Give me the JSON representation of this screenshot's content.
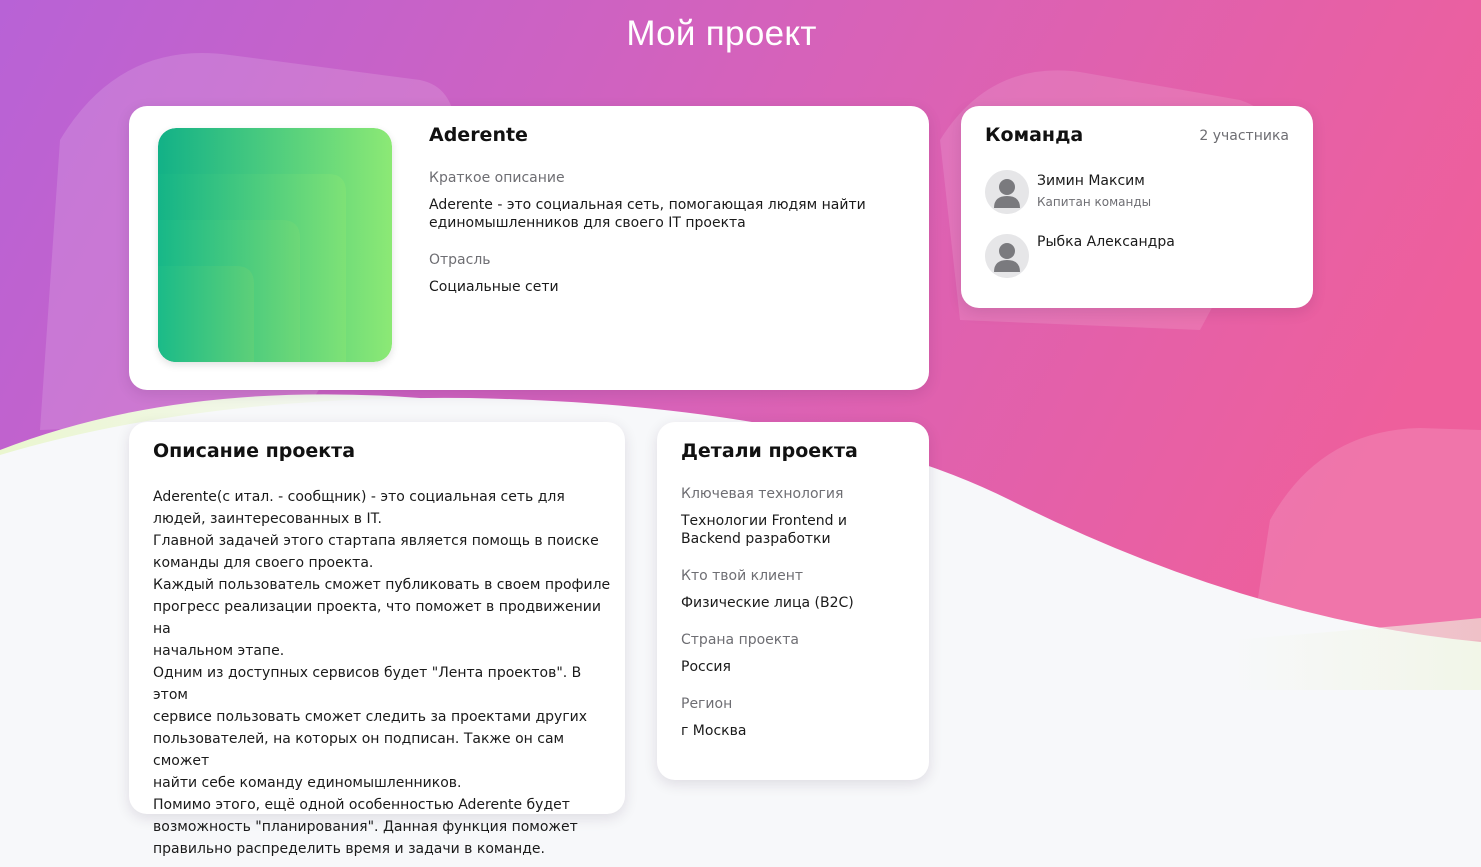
{
  "page_title": "Мой проект",
  "project": {
    "name": "Aderente",
    "short_description_label": "Краткое описание",
    "short_description_line1": "Aderente - это социальная сеть, помогающая людям найти",
    "short_description_line2": "единомышленников для своего IT проекта",
    "industry_label": "Отрасль",
    "industry_value": "Социальные сети"
  },
  "team": {
    "title": "Команда",
    "count": "2 участника",
    "members": [
      {
        "name": "Зимин Максим",
        "role": "Капитан команды"
      },
      {
        "name": "Рыбка Александра",
        "role": ""
      }
    ]
  },
  "description": {
    "title": "Описание проекта",
    "lines": [
      "Aderente(с итал. - сообщник) - это социальная сеть для",
      "людей, заинтересованных в IT.",
      "Главной задачей этого стартапа является помощь в поиске",
      "команды для своего проекта.",
      "Каждый пользователь сможет публиковать в своем профиле",
      "прогресс реализации проекта, что поможет в продвижении на",
      "начальном этапе.",
      "Одним из доступных сервисов будет \"Лента проектов\". В этом",
      "сервисе пользовать сможет следить за проектами других",
      "пользователей, на которых он подписан. Также он сам сможет",
      "найти себе команду единомышленников.",
      "Помимо этого, ещё одной особенностью Aderente будет",
      "возможность \"планирования\". Данная функция поможет",
      "правильно распределить время и задачи в команде."
    ]
  },
  "details": {
    "title": "Детали проекта",
    "technology_label": "Ключевая технология",
    "technology_line1": "Технологии Frontend и",
    "technology_line2": "Backend разработки",
    "client_label": "Кто твой клиент",
    "client_value": "Физические лица (B2C)",
    "country_label": "Страна проекта",
    "country_value": "Россия",
    "region_label": "Регион",
    "region_value": "г Москва"
  },
  "colors": {
    "bg_gradient_start": "#b862d6",
    "bg_gradient_end": "#ee5f9c",
    "logo_gradient_start": "#12b187",
    "logo_gradient_end": "#8ce975",
    "wave_light": "#f7f8fa",
    "wave_green_tint": "#eef6d8"
  }
}
